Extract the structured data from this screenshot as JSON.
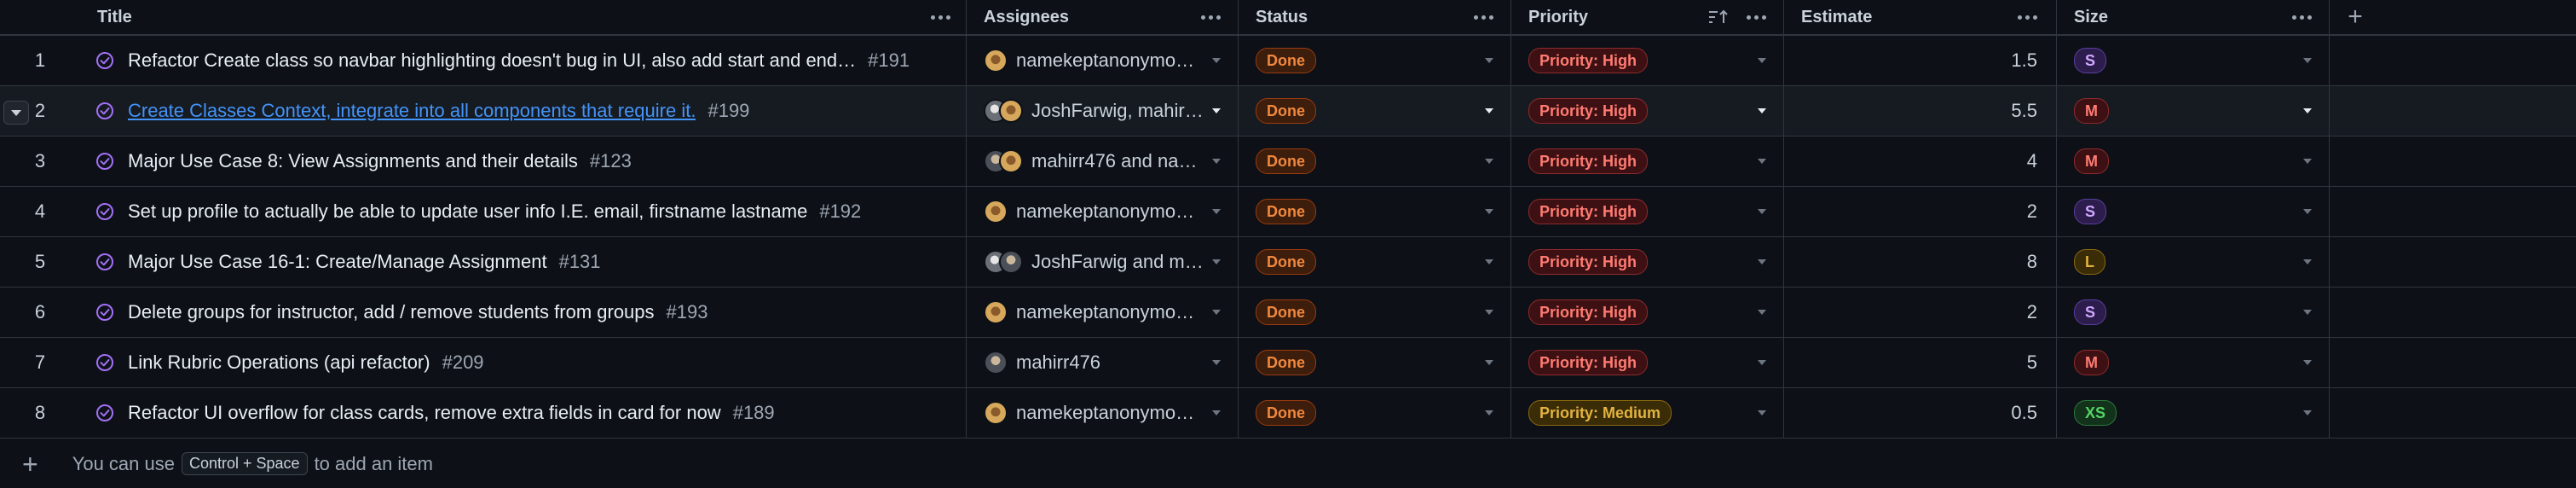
{
  "columns": {
    "title": "Title",
    "assignees": "Assignees",
    "status": "Status",
    "priority": "Priority",
    "estimate": "Estimate",
    "size": "Size"
  },
  "rows": [
    {
      "num": "1",
      "title": "Refactor Create class so navbar highlighting doesn't bug in UI, also add start and end…",
      "issue": "#191",
      "assignees": "namekeptanonymo…",
      "avatars": [
        "gold"
      ],
      "status": "Done",
      "priority": "Priority: High",
      "estimate": "1.5",
      "size": "S"
    },
    {
      "num": "2",
      "title": "Create Classes Context, integrate into all components that require it.",
      "issue": "#199",
      "assignees": "JoshFarwig, mahir…",
      "avatars": [
        "gray",
        "gold"
      ],
      "status": "Done",
      "priority": "Priority: High",
      "estimate": "5.5",
      "size": "M"
    },
    {
      "num": "3",
      "title": "Major Use Case 8: View Assignments and their details",
      "issue": "#123",
      "assignees": "mahirr476 and na…",
      "avatars": [
        "dark",
        "gold"
      ],
      "status": "Done",
      "priority": "Priority: High",
      "estimate": "4",
      "size": "M"
    },
    {
      "num": "4",
      "title": "Set up profile to actually be able to update user info I.E. email, firstname lastname",
      "issue": "#192",
      "assignees": "namekeptanonymo…",
      "avatars": [
        "gold"
      ],
      "status": "Done",
      "priority": "Priority: High",
      "estimate": "2",
      "size": "S"
    },
    {
      "num": "5",
      "title": "Major Use Case 16-1: Create/Manage Assignment",
      "issue": "#131",
      "assignees": "JoshFarwig and m…",
      "avatars": [
        "gray",
        "dark"
      ],
      "status": "Done",
      "priority": "Priority: High",
      "estimate": "8",
      "size": "L"
    },
    {
      "num": "6",
      "title": "Delete groups for instructor, add / remove students from groups",
      "issue": "#193",
      "assignees": "namekeptanonymo…",
      "avatars": [
        "gold"
      ],
      "status": "Done",
      "priority": "Priority: High",
      "estimate": "2",
      "size": "S"
    },
    {
      "num": "7",
      "title": "Link Rubric Operations (api refactor)",
      "issue": "#209",
      "assignees": "mahirr476",
      "avatars": [
        "dark"
      ],
      "status": "Done",
      "priority": "Priority: High",
      "estimate": "5",
      "size": "M"
    },
    {
      "num": "8",
      "title": "Refactor UI overflow for class cards, remove extra fields in card for now",
      "issue": "#189",
      "assignees": "namekeptanonymo…",
      "avatars": [
        "gold"
      ],
      "status": "Done",
      "priority": "Priority: Medium",
      "estimate": "0.5",
      "size": "XS"
    }
  ],
  "footer": {
    "prefix": "You can use",
    "shortcut": "Control + Space",
    "suffix": "to add an item"
  },
  "icons": {
    "issue_closed": "check-circle-icon",
    "more": "kebab-icon",
    "add_column": "plus-icon",
    "sort": "sort-ascending-icon",
    "dropdown": "chevron-down-icon"
  },
  "colors": {
    "background": "#0d1117",
    "link": "#4493f8",
    "issue_closed": "#a371f7"
  }
}
